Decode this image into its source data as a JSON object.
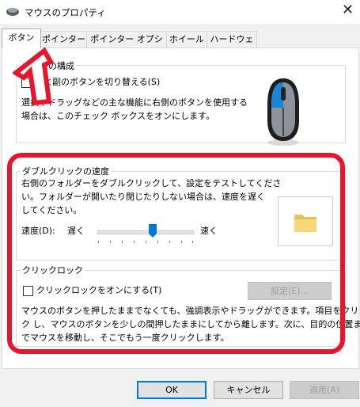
{
  "window": {
    "title": "マウスのプロパティ",
    "close_glyph": "✕"
  },
  "tabs": [
    {
      "label": "ボタン",
      "active": true
    },
    {
      "label": "ポインター"
    },
    {
      "label": "ポインター オプション"
    },
    {
      "label": "ホイール"
    },
    {
      "label": "ハードウェア"
    }
  ],
  "button_config": {
    "title": "ボタンの構成",
    "checkbox_label": "主と副のボタンを切り替える(S)",
    "checked": false,
    "description": [
      "選択やドラッグなどの主な機能に右側のボタンを使用する",
      "場合は、このチェック ボックスをオンにします。"
    ]
  },
  "double_click": {
    "title": "ダブルクリックの速度",
    "description": [
      "右側のフォルダーをダブルクリックして、設定をテストしてくださ",
      "い。フォルダーが開いたり閉じたりしない場合は、速度を遅く",
      "してください。"
    ],
    "speed_label": "速度(D):",
    "slow_label": "遅く",
    "fast_label": "速く",
    "slider_value_fraction": 0.6
  },
  "click_lock": {
    "title": "クリックロック",
    "checkbox_label": "クリックロックをオンにする(T)",
    "checked": false,
    "settings_button": "設定(E)...",
    "description": [
      "マウスのボタンを押したままでなくても、強調表示やドラッグができます。項目をクリッ",
      "ク し、マウスのボタンを少しの間押したままにしてから離します。次に、目的の位置ま",
      "でマウスを移動し、そこでもう一度クリックします。"
    ]
  },
  "footer": {
    "ok": "OK",
    "cancel": "キャンセル",
    "apply": "適用(A)"
  },
  "colors": {
    "annotation_red": "#e8162d",
    "mouse_accent": "#1a86d9"
  }
}
